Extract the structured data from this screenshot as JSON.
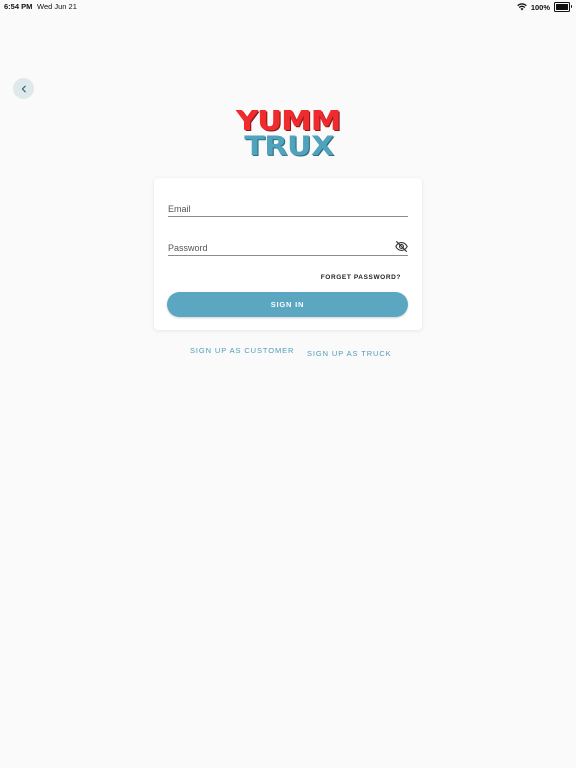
{
  "status_bar": {
    "time": "6:54 PM",
    "date": "Wed Jun 21",
    "battery": "100%"
  },
  "icons": {
    "back": "chevron-left-icon",
    "password_visibility": "eye-off-icon",
    "wifi": "wifi-icon",
    "battery": "battery-icon"
  },
  "logo": {
    "line1": "YUMM",
    "line2": "TRUX"
  },
  "form": {
    "email_placeholder": "Email",
    "email_value": "",
    "password_placeholder": "Password",
    "password_value": "",
    "forgot_label": "FORGET PASSWORD?",
    "sign_in_label": "SIGN IN"
  },
  "links": {
    "signup_customer": "SIGN UP AS CUSTOMER",
    "signup_truck": "SIGN UP AS TRUCK"
  },
  "colors": {
    "primary": "#5ba6c0",
    "logo_red": "#ef2b2d",
    "logo_blue": "#4fa3bd",
    "background": "#fafafa"
  }
}
